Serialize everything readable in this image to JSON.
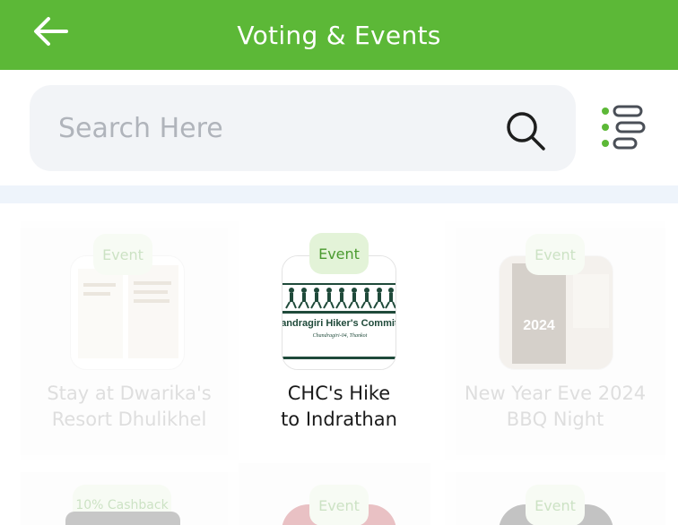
{
  "header": {
    "title": "Voting & Events"
  },
  "search": {
    "placeholder": "Search Here"
  },
  "cards": [
    {
      "badge": "Event",
      "title_line1": "Stay at Dwarika's",
      "title_line2": "Resort Dhulikhel"
    },
    {
      "badge": "Event",
      "title_line1": "CHC's Hike",
      "title_line2": "to Indrathan",
      "logo_title": "Chandragiri Hiker's Committee",
      "logo_subtitle": "Chandragiri-04, Thankot"
    },
    {
      "badge": "Event",
      "title_line1": "New Year Eve 2024",
      "title_line2": "BBQ Night",
      "poster_text": "2024"
    }
  ],
  "lower_cards": [
    {
      "badge": "10% Cashback"
    },
    {
      "badge": "Event"
    },
    {
      "badge": "Event"
    }
  ],
  "colors": {
    "header_bg": "#5cb837",
    "badge_bg": "#e3f3d8",
    "badge_text": "#4a9a2f"
  }
}
